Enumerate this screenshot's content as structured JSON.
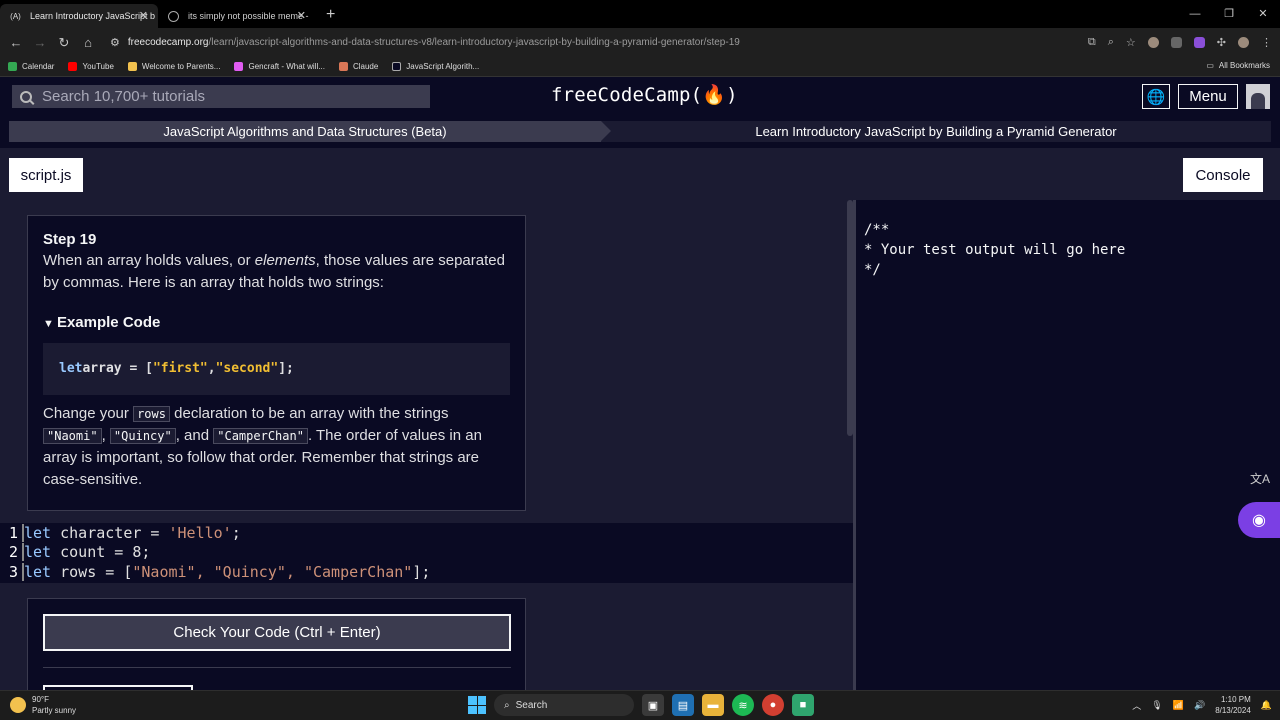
{
  "browser": {
    "tabs": [
      {
        "title": "Learn Introductory JavaScript b",
        "favicon": "(A)",
        "active": true
      },
      {
        "title": "its simply not possible meme -",
        "favicon": "globe-icon",
        "active": false
      }
    ],
    "url_host": "freecodecamp.org",
    "url_path": "/learn/javascript-algorithms-and-data-structures-v8/learn-introductory-javascript-by-building-a-pyramid-generator/step-19",
    "bookmarks": [
      {
        "label": "Calendar",
        "color": "#34a853"
      },
      {
        "label": "YouTube",
        "color": "#ff0000"
      },
      {
        "label": "Welcome to Parents...",
        "color": "#f2c14e"
      },
      {
        "label": "Gencraft - What will...",
        "color": "#e05cf2"
      },
      {
        "label": "Claude",
        "color": "#d97757"
      },
      {
        "label": "JavaScript Algorith...",
        "color": "#0a0a23"
      }
    ],
    "all_bookmarks": "All Bookmarks"
  },
  "fcc": {
    "search_placeholder": "Search 10,700+ tutorials",
    "logo": "freeCodeCamp(🔥)",
    "menu_label": "Menu",
    "breadcrumb_superblock": "JavaScript Algorithms and Data Structures (Beta)",
    "breadcrumb_block": "Learn Introductory JavaScript by Building a Pyramid Generator",
    "file_tab": "script.js",
    "console_tab": "Console"
  },
  "lesson": {
    "step_title": "Step 19",
    "intro_a": "When an array holds values, or ",
    "intro_em": "elements",
    "intro_b": ", those values are separated by commas. Here is an array that holds two strings:",
    "example_summary": "Example Code",
    "example_kw": "let",
    "example_var": " array = [",
    "example_s1": "\"first\"",
    "example_sep": ", ",
    "example_s2": "\"second\"",
    "example_end": "];",
    "p2_a": "Change your ",
    "p2_code1": "rows",
    "p2_b": " declaration to be an array with the strings ",
    "p2_code2": "\"Naomi\"",
    "p2_c": ", ",
    "p2_code3": "\"Quincy\"",
    "p2_d": ", and ",
    "p2_code4": "\"CamperChan\"",
    "p2_e": ". The order of values in an array is important, so follow that order. Remember that strings are case-sensitive."
  },
  "editor": {
    "lines": [
      {
        "num": "1",
        "kw": "let",
        "rest": " character = ",
        "str": "'Hello'",
        "end": ";"
      },
      {
        "num": "2",
        "kw": "let",
        "rest": " count = 8;",
        "str": "",
        "end": ""
      },
      {
        "num": "3",
        "kw": "let",
        "rest": " rows = [",
        "str": "\"Naomi\", \"Quincy\", \"CamperChan\"",
        "end": "];"
      }
    ]
  },
  "check_button": "Check Your Code (Ctrl + Enter)",
  "console_output": "/**\n* Your test output will go here\n*/",
  "taskbar": {
    "temp": "90°F",
    "weather": "Partly sunny",
    "search": "Search",
    "time": "1:10 PM",
    "date": "8/13/2024"
  }
}
